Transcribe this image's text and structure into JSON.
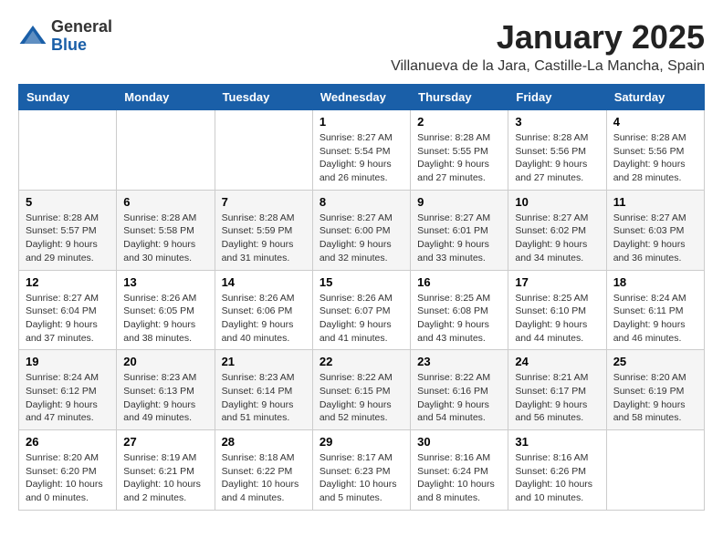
{
  "logo": {
    "general": "General",
    "blue": "Blue"
  },
  "title": "January 2025",
  "location": "Villanueva de la Jara, Castille-La Mancha, Spain",
  "days_of_week": [
    "Sunday",
    "Monday",
    "Tuesday",
    "Wednesday",
    "Thursday",
    "Friday",
    "Saturday"
  ],
  "weeks": [
    [
      {
        "day": "",
        "info": ""
      },
      {
        "day": "",
        "info": ""
      },
      {
        "day": "",
        "info": ""
      },
      {
        "day": "1",
        "info": "Sunrise: 8:27 AM\nSunset: 5:54 PM\nDaylight: 9 hours and 26 minutes."
      },
      {
        "day": "2",
        "info": "Sunrise: 8:28 AM\nSunset: 5:55 PM\nDaylight: 9 hours and 27 minutes."
      },
      {
        "day": "3",
        "info": "Sunrise: 8:28 AM\nSunset: 5:56 PM\nDaylight: 9 hours and 27 minutes."
      },
      {
        "day": "4",
        "info": "Sunrise: 8:28 AM\nSunset: 5:56 PM\nDaylight: 9 hours and 28 minutes."
      }
    ],
    [
      {
        "day": "5",
        "info": "Sunrise: 8:28 AM\nSunset: 5:57 PM\nDaylight: 9 hours and 29 minutes."
      },
      {
        "day": "6",
        "info": "Sunrise: 8:28 AM\nSunset: 5:58 PM\nDaylight: 9 hours and 30 minutes."
      },
      {
        "day": "7",
        "info": "Sunrise: 8:28 AM\nSunset: 5:59 PM\nDaylight: 9 hours and 31 minutes."
      },
      {
        "day": "8",
        "info": "Sunrise: 8:27 AM\nSunset: 6:00 PM\nDaylight: 9 hours and 32 minutes."
      },
      {
        "day": "9",
        "info": "Sunrise: 8:27 AM\nSunset: 6:01 PM\nDaylight: 9 hours and 33 minutes."
      },
      {
        "day": "10",
        "info": "Sunrise: 8:27 AM\nSunset: 6:02 PM\nDaylight: 9 hours and 34 minutes."
      },
      {
        "day": "11",
        "info": "Sunrise: 8:27 AM\nSunset: 6:03 PM\nDaylight: 9 hours and 36 minutes."
      }
    ],
    [
      {
        "day": "12",
        "info": "Sunrise: 8:27 AM\nSunset: 6:04 PM\nDaylight: 9 hours and 37 minutes."
      },
      {
        "day": "13",
        "info": "Sunrise: 8:26 AM\nSunset: 6:05 PM\nDaylight: 9 hours and 38 minutes."
      },
      {
        "day": "14",
        "info": "Sunrise: 8:26 AM\nSunset: 6:06 PM\nDaylight: 9 hours and 40 minutes."
      },
      {
        "day": "15",
        "info": "Sunrise: 8:26 AM\nSunset: 6:07 PM\nDaylight: 9 hours and 41 minutes."
      },
      {
        "day": "16",
        "info": "Sunrise: 8:25 AM\nSunset: 6:08 PM\nDaylight: 9 hours and 43 minutes."
      },
      {
        "day": "17",
        "info": "Sunrise: 8:25 AM\nSunset: 6:10 PM\nDaylight: 9 hours and 44 minutes."
      },
      {
        "day": "18",
        "info": "Sunrise: 8:24 AM\nSunset: 6:11 PM\nDaylight: 9 hours and 46 minutes."
      }
    ],
    [
      {
        "day": "19",
        "info": "Sunrise: 8:24 AM\nSunset: 6:12 PM\nDaylight: 9 hours and 47 minutes."
      },
      {
        "day": "20",
        "info": "Sunrise: 8:23 AM\nSunset: 6:13 PM\nDaylight: 9 hours and 49 minutes."
      },
      {
        "day": "21",
        "info": "Sunrise: 8:23 AM\nSunset: 6:14 PM\nDaylight: 9 hours and 51 minutes."
      },
      {
        "day": "22",
        "info": "Sunrise: 8:22 AM\nSunset: 6:15 PM\nDaylight: 9 hours and 52 minutes."
      },
      {
        "day": "23",
        "info": "Sunrise: 8:22 AM\nSunset: 6:16 PM\nDaylight: 9 hours and 54 minutes."
      },
      {
        "day": "24",
        "info": "Sunrise: 8:21 AM\nSunset: 6:17 PM\nDaylight: 9 hours and 56 minutes."
      },
      {
        "day": "25",
        "info": "Sunrise: 8:20 AM\nSunset: 6:19 PM\nDaylight: 9 hours and 58 minutes."
      }
    ],
    [
      {
        "day": "26",
        "info": "Sunrise: 8:20 AM\nSunset: 6:20 PM\nDaylight: 10 hours and 0 minutes."
      },
      {
        "day": "27",
        "info": "Sunrise: 8:19 AM\nSunset: 6:21 PM\nDaylight: 10 hours and 2 minutes."
      },
      {
        "day": "28",
        "info": "Sunrise: 8:18 AM\nSunset: 6:22 PM\nDaylight: 10 hours and 4 minutes."
      },
      {
        "day": "29",
        "info": "Sunrise: 8:17 AM\nSunset: 6:23 PM\nDaylight: 10 hours and 5 minutes."
      },
      {
        "day": "30",
        "info": "Sunrise: 8:16 AM\nSunset: 6:24 PM\nDaylight: 10 hours and 8 minutes."
      },
      {
        "day": "31",
        "info": "Sunrise: 8:16 AM\nSunset: 6:26 PM\nDaylight: 10 hours and 10 minutes."
      },
      {
        "day": "",
        "info": ""
      }
    ]
  ]
}
